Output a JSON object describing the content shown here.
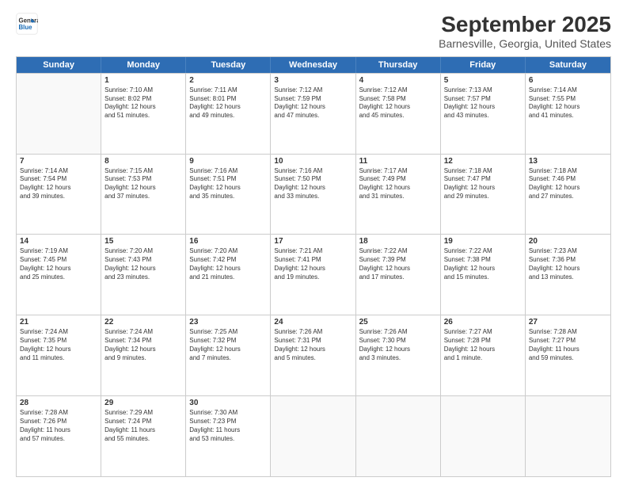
{
  "logo": {
    "line1": "General",
    "line2": "Blue"
  },
  "title": "September 2025",
  "subtitle": "Barnesville, Georgia, United States",
  "header_days": [
    "Sunday",
    "Monday",
    "Tuesday",
    "Wednesday",
    "Thursday",
    "Friday",
    "Saturday"
  ],
  "weeks": [
    [
      {
        "day": "",
        "info": ""
      },
      {
        "day": "1",
        "info": "Sunrise: 7:10 AM\nSunset: 8:02 PM\nDaylight: 12 hours\nand 51 minutes."
      },
      {
        "day": "2",
        "info": "Sunrise: 7:11 AM\nSunset: 8:01 PM\nDaylight: 12 hours\nand 49 minutes."
      },
      {
        "day": "3",
        "info": "Sunrise: 7:12 AM\nSunset: 7:59 PM\nDaylight: 12 hours\nand 47 minutes."
      },
      {
        "day": "4",
        "info": "Sunrise: 7:12 AM\nSunset: 7:58 PM\nDaylight: 12 hours\nand 45 minutes."
      },
      {
        "day": "5",
        "info": "Sunrise: 7:13 AM\nSunset: 7:57 PM\nDaylight: 12 hours\nand 43 minutes."
      },
      {
        "day": "6",
        "info": "Sunrise: 7:14 AM\nSunset: 7:55 PM\nDaylight: 12 hours\nand 41 minutes."
      }
    ],
    [
      {
        "day": "7",
        "info": "Sunrise: 7:14 AM\nSunset: 7:54 PM\nDaylight: 12 hours\nand 39 minutes."
      },
      {
        "day": "8",
        "info": "Sunrise: 7:15 AM\nSunset: 7:53 PM\nDaylight: 12 hours\nand 37 minutes."
      },
      {
        "day": "9",
        "info": "Sunrise: 7:16 AM\nSunset: 7:51 PM\nDaylight: 12 hours\nand 35 minutes."
      },
      {
        "day": "10",
        "info": "Sunrise: 7:16 AM\nSunset: 7:50 PM\nDaylight: 12 hours\nand 33 minutes."
      },
      {
        "day": "11",
        "info": "Sunrise: 7:17 AM\nSunset: 7:49 PM\nDaylight: 12 hours\nand 31 minutes."
      },
      {
        "day": "12",
        "info": "Sunrise: 7:18 AM\nSunset: 7:47 PM\nDaylight: 12 hours\nand 29 minutes."
      },
      {
        "day": "13",
        "info": "Sunrise: 7:18 AM\nSunset: 7:46 PM\nDaylight: 12 hours\nand 27 minutes."
      }
    ],
    [
      {
        "day": "14",
        "info": "Sunrise: 7:19 AM\nSunset: 7:45 PM\nDaylight: 12 hours\nand 25 minutes."
      },
      {
        "day": "15",
        "info": "Sunrise: 7:20 AM\nSunset: 7:43 PM\nDaylight: 12 hours\nand 23 minutes."
      },
      {
        "day": "16",
        "info": "Sunrise: 7:20 AM\nSunset: 7:42 PM\nDaylight: 12 hours\nand 21 minutes."
      },
      {
        "day": "17",
        "info": "Sunrise: 7:21 AM\nSunset: 7:41 PM\nDaylight: 12 hours\nand 19 minutes."
      },
      {
        "day": "18",
        "info": "Sunrise: 7:22 AM\nSunset: 7:39 PM\nDaylight: 12 hours\nand 17 minutes."
      },
      {
        "day": "19",
        "info": "Sunrise: 7:22 AM\nSunset: 7:38 PM\nDaylight: 12 hours\nand 15 minutes."
      },
      {
        "day": "20",
        "info": "Sunrise: 7:23 AM\nSunset: 7:36 PM\nDaylight: 12 hours\nand 13 minutes."
      }
    ],
    [
      {
        "day": "21",
        "info": "Sunrise: 7:24 AM\nSunset: 7:35 PM\nDaylight: 12 hours\nand 11 minutes."
      },
      {
        "day": "22",
        "info": "Sunrise: 7:24 AM\nSunset: 7:34 PM\nDaylight: 12 hours\nand 9 minutes."
      },
      {
        "day": "23",
        "info": "Sunrise: 7:25 AM\nSunset: 7:32 PM\nDaylight: 12 hours\nand 7 minutes."
      },
      {
        "day": "24",
        "info": "Sunrise: 7:26 AM\nSunset: 7:31 PM\nDaylight: 12 hours\nand 5 minutes."
      },
      {
        "day": "25",
        "info": "Sunrise: 7:26 AM\nSunset: 7:30 PM\nDaylight: 12 hours\nand 3 minutes."
      },
      {
        "day": "26",
        "info": "Sunrise: 7:27 AM\nSunset: 7:28 PM\nDaylight: 12 hours\nand 1 minute."
      },
      {
        "day": "27",
        "info": "Sunrise: 7:28 AM\nSunset: 7:27 PM\nDaylight: 11 hours\nand 59 minutes."
      }
    ],
    [
      {
        "day": "28",
        "info": "Sunrise: 7:28 AM\nSunset: 7:26 PM\nDaylight: 11 hours\nand 57 minutes."
      },
      {
        "day": "29",
        "info": "Sunrise: 7:29 AM\nSunset: 7:24 PM\nDaylight: 11 hours\nand 55 minutes."
      },
      {
        "day": "30",
        "info": "Sunrise: 7:30 AM\nSunset: 7:23 PM\nDaylight: 11 hours\nand 53 minutes."
      },
      {
        "day": "",
        "info": ""
      },
      {
        "day": "",
        "info": ""
      },
      {
        "day": "",
        "info": ""
      },
      {
        "day": "",
        "info": ""
      }
    ]
  ]
}
